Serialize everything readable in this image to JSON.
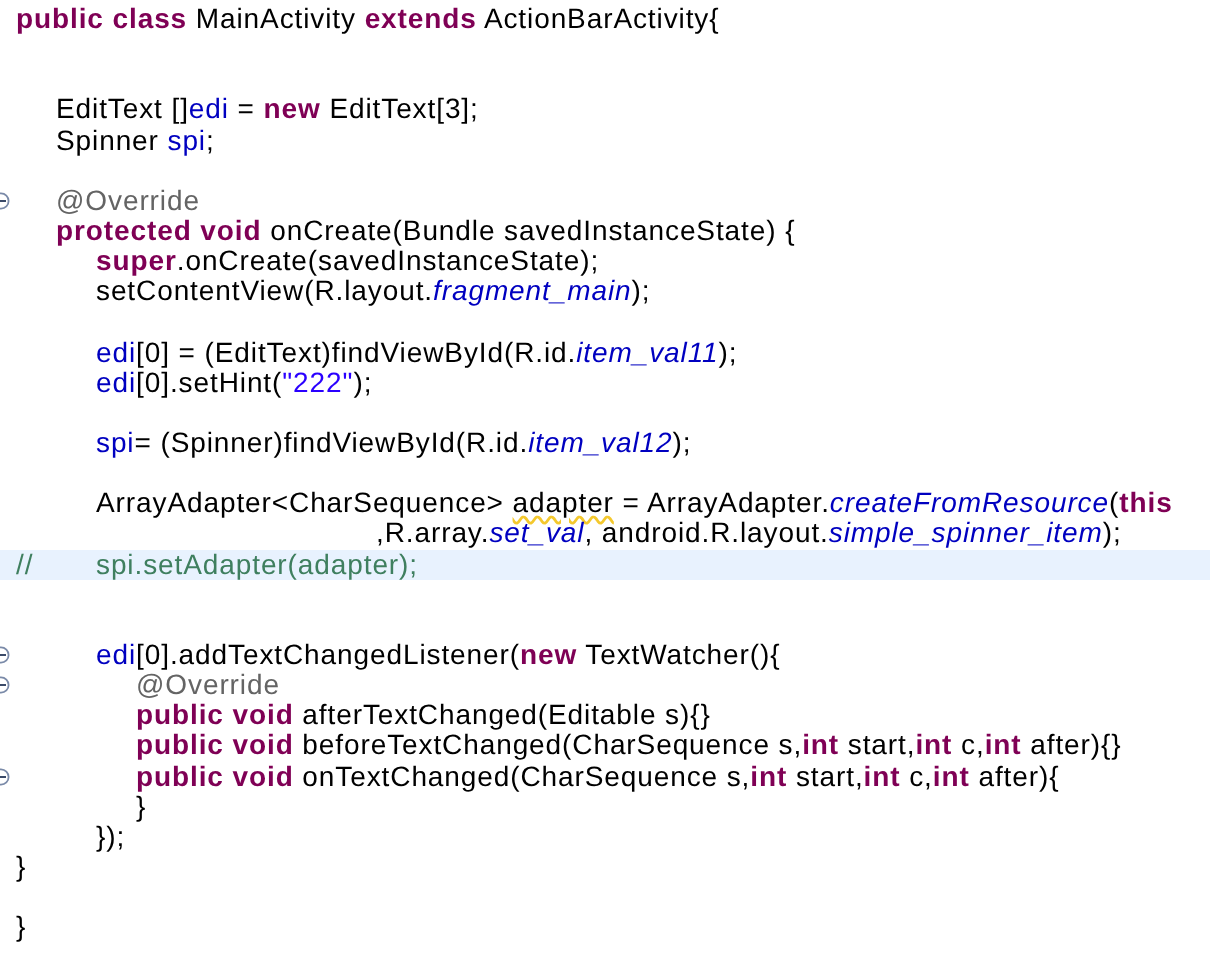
{
  "editor": {
    "lines": [
      {
        "fold": false,
        "highlighted": false,
        "tokens": [
          {
            "kind": "keyword",
            "text": "public"
          },
          {
            "kind": "keyword",
            "text": " class"
          },
          {
            "kind": "plain",
            "text": " MainActivity "
          },
          {
            "kind": "keyword",
            "text": "extends"
          },
          {
            "kind": "plain",
            "text": " ActionBarActivity{"
          }
        ]
      },
      {
        "fold": false,
        "highlighted": false
      },
      {
        "fold": false,
        "highlighted": false
      },
      {
        "fold": false,
        "highlighted": false,
        "tokens": [
          {
            "kind": "plain",
            "text": "\tEditText []"
          },
          {
            "kind": "field",
            "text": "edi"
          },
          {
            "kind": "plain",
            "text": " = "
          },
          {
            "kind": "keyword",
            "text": "new"
          },
          {
            "kind": "plain",
            "text": " EditText[3];"
          }
        ]
      },
      {
        "fold": false,
        "highlighted": false,
        "tokens": [
          {
            "kind": "plain",
            "text": "\tSpinner "
          },
          {
            "kind": "field",
            "text": "spi"
          },
          {
            "kind": "plain",
            "text": ";"
          }
        ]
      },
      {
        "fold": false,
        "highlighted": false
      },
      {
        "fold": true,
        "highlighted": false,
        "tokens": [
          {
            "kind": "annotation",
            "text": "\t@Override"
          }
        ]
      },
      {
        "fold": false,
        "highlighted": false,
        "tokens": [
          {
            "kind": "keyword",
            "text": "\tprotected"
          },
          {
            "kind": "keyword",
            "text": " void"
          },
          {
            "kind": "plain",
            "text": " onCreate(Bundle savedInstanceState) {"
          }
        ]
      },
      {
        "fold": false,
        "highlighted": false,
        "tokens": [
          {
            "kind": "keyword",
            "text": "\t\tsuper"
          },
          {
            "kind": "plain",
            "text": ".onCreate(savedInstanceState);"
          }
        ]
      },
      {
        "fold": false,
        "highlighted": false,
        "tokens": [
          {
            "kind": "plain",
            "text": "\t\tsetContentView(R.layout."
          },
          {
            "kind": "static",
            "text": "fragment_main"
          },
          {
            "kind": "plain",
            "text": ");"
          }
        ]
      },
      {
        "fold": false,
        "highlighted": false
      },
      {
        "fold": false,
        "highlighted": false,
        "tokens": [
          {
            "kind": "field",
            "text": "\t\tedi"
          },
          {
            "kind": "plain",
            "text": "[0] = (EditText)findViewById(R.id."
          },
          {
            "kind": "static",
            "text": "item_val11"
          },
          {
            "kind": "plain",
            "text": ");"
          }
        ]
      },
      {
        "fold": false,
        "highlighted": false,
        "tokens": [
          {
            "kind": "field",
            "text": "\t\tedi"
          },
          {
            "kind": "plain",
            "text": "[0].setHint("
          },
          {
            "kind": "string",
            "text": "\"222\""
          },
          {
            "kind": "plain",
            "text": ");"
          }
        ]
      },
      {
        "fold": false,
        "highlighted": false
      },
      {
        "fold": false,
        "highlighted": false,
        "tokens": [
          {
            "kind": "field",
            "text": "\t\tspi"
          },
          {
            "kind": "plain",
            "text": "= (Spinner)findViewById(R.id."
          },
          {
            "kind": "static",
            "text": "item_val12"
          },
          {
            "kind": "plain",
            "text": ");"
          }
        ]
      },
      {
        "fold": false,
        "highlighted": false
      },
      {
        "fold": false,
        "highlighted": false,
        "tokens": [
          {
            "kind": "plain",
            "text": "\t\tArrayAdapter<CharSequence> "
          },
          {
            "kind": "warning",
            "text": "adapter"
          },
          {
            "kind": "plain",
            "text": " = ArrayAdapter."
          },
          {
            "kind": "static",
            "text": "createFromResource"
          },
          {
            "kind": "plain",
            "text": "("
          },
          {
            "kind": "keyword",
            "text": "this"
          }
        ]
      },
      {
        "fold": false,
        "highlighted": false,
        "tokens": [
          {
            "kind": "plain",
            "text": "\t\t\t\t\t\t\t\t\t,R.array."
          },
          {
            "kind": "static",
            "text": "set_val"
          },
          {
            "kind": "plain",
            "text": ", android.R.layout."
          },
          {
            "kind": "static",
            "text": "simple_spinner_item"
          },
          {
            "kind": "plain",
            "text": ");"
          }
        ]
      },
      {
        "fold": false,
        "highlighted": true,
        "tokens": [
          {
            "kind": "comment",
            "text": "//\t\tspi.setAdapter(adapter);"
          }
        ]
      },
      {
        "fold": false,
        "highlighted": false
      },
      {
        "fold": false,
        "highlighted": false
      },
      {
        "fold": true,
        "highlighted": false,
        "tokens": [
          {
            "kind": "field",
            "text": "\t\tedi"
          },
          {
            "kind": "plain",
            "text": "[0].addTextChangedListener("
          },
          {
            "kind": "keyword",
            "text": "new"
          },
          {
            "kind": "plain",
            "text": " TextWatcher(){"
          }
        ]
      },
      {
        "fold": true,
        "highlighted": false,
        "tokens": [
          {
            "kind": "annotation",
            "text": "\t\t\t@Override"
          }
        ]
      },
      {
        "fold": false,
        "highlighted": false,
        "tokens": [
          {
            "kind": "keyword",
            "text": "\t\t\tpublic"
          },
          {
            "kind": "keyword",
            "text": " void"
          },
          {
            "kind": "plain",
            "text": " afterTextChanged(Editable s){}"
          }
        ]
      },
      {
        "fold": false,
        "highlighted": false,
        "tokens": [
          {
            "kind": "keyword",
            "text": "\t\t\tpublic"
          },
          {
            "kind": "keyword",
            "text": " void"
          },
          {
            "kind": "plain",
            "text": " beforeTextChanged(CharSequence s,"
          },
          {
            "kind": "keyword",
            "text": "int"
          },
          {
            "kind": "plain",
            "text": " start,"
          },
          {
            "kind": "keyword",
            "text": "int"
          },
          {
            "kind": "plain",
            "text": " c,"
          },
          {
            "kind": "keyword",
            "text": "int"
          },
          {
            "kind": "plain",
            "text": " after){}"
          }
        ]
      },
      {
        "fold": true,
        "highlighted": false,
        "tokens": [
          {
            "kind": "keyword",
            "text": "\t\t\tpublic"
          },
          {
            "kind": "keyword",
            "text": " void"
          },
          {
            "kind": "plain",
            "text": " onTextChanged(CharSequence s,"
          },
          {
            "kind": "keyword",
            "text": "int"
          },
          {
            "kind": "plain",
            "text": " start,"
          },
          {
            "kind": "keyword",
            "text": "int"
          },
          {
            "kind": "plain",
            "text": " c,"
          },
          {
            "kind": "keyword",
            "text": "int"
          },
          {
            "kind": "plain",
            "text": " after){"
          }
        ]
      },
      {
        "fold": false,
        "highlighted": false,
        "tokens": [
          {
            "kind": "plain",
            "text": "\t\t\t}"
          }
        ]
      },
      {
        "fold": false,
        "highlighted": false,
        "tokens": [
          {
            "kind": "plain",
            "text": "\t\t});"
          }
        ]
      },
      {
        "fold": false,
        "highlighted": false,
        "tokens": [
          {
            "kind": "plain",
            "text": "}"
          }
        ]
      },
      {
        "fold": false,
        "highlighted": false
      },
      {
        "fold": false,
        "highlighted": false,
        "tokens": [
          {
            "kind": "plain",
            "text": "}"
          }
        ]
      }
    ]
  }
}
